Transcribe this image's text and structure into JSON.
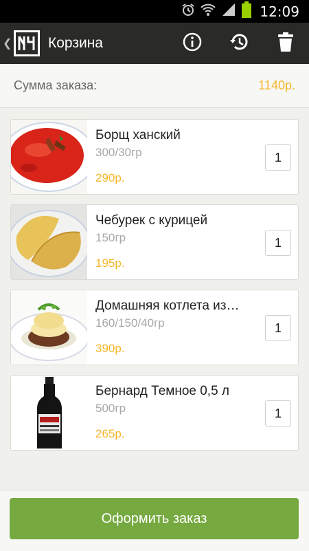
{
  "status_bar": {
    "time": "12:09"
  },
  "header": {
    "title": "Корзина"
  },
  "summary": {
    "label": "Сумма заказа:",
    "value": "1140р."
  },
  "items": [
    {
      "name": "Борщ ханский",
      "weight": "300/30гр",
      "price": "290р.",
      "qty": "1"
    },
    {
      "name": "Чебурек с курицей",
      "weight": "150гр",
      "price": "195р.",
      "qty": "1"
    },
    {
      "name": "Домашняя котлета из…",
      "weight": "160/150/40гр",
      "price": "390р.",
      "qty": "1"
    },
    {
      "name": "Бернард Темное 0,5 л",
      "weight": "500гр",
      "price": "265р.",
      "qty": "1"
    }
  ],
  "order_button": {
    "label": "Оформить заказ"
  },
  "colors": {
    "accent": "#f4b62a",
    "button": "#76a940",
    "header": "#2a2a28"
  },
  "icons": [
    "alarm-icon",
    "wifi-icon",
    "signal-icon",
    "battery-icon",
    "info-icon",
    "history-icon",
    "trash-icon"
  ]
}
